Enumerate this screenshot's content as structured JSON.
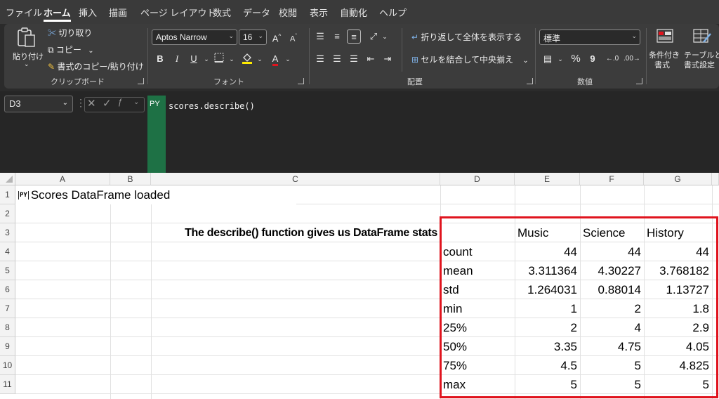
{
  "menu": {
    "tabs": [
      {
        "label": "ファイル",
        "active": false
      },
      {
        "label": "ホーム",
        "active": true
      },
      {
        "label": "挿入",
        "active": false
      },
      {
        "label": "描画",
        "active": false
      },
      {
        "label": "ページ レイアウト",
        "active": false
      },
      {
        "label": "数式",
        "active": false
      },
      {
        "label": "データ",
        "active": false
      },
      {
        "label": "校閲",
        "active": false
      },
      {
        "label": "表示",
        "active": false
      },
      {
        "label": "自動化",
        "active": false
      },
      {
        "label": "ヘルプ",
        "active": false
      }
    ]
  },
  "ribbon": {
    "clipboard": {
      "paste_label": "貼り付け",
      "cut_label": "切り取り",
      "copy_label": "コピー",
      "format_painter_label": "書式のコピー/貼り付け",
      "group_label": "クリップボード"
    },
    "font": {
      "font_name": "Aptos Narrow",
      "font_size": "16",
      "group_label": "フォント"
    },
    "alignment": {
      "wrap_text_label": "折り返して全体を表示する",
      "merge_center_label": "セルを結合して中央揃え",
      "group_label": "配置"
    },
    "number": {
      "format_value": "標準",
      "percent_label": "%",
      "comma_label": "9",
      "group_label": "数値"
    },
    "styles": {
      "conditional_label_1": "条件付き",
      "conditional_label_2": "書式",
      "table_label_1": "テーブルとし",
      "table_label_2": "書式設定"
    }
  },
  "formula_bar": {
    "name_box": "D3",
    "py_badge": "PY",
    "formula": "scores.describe()"
  },
  "sheet": {
    "columns": [
      "A",
      "B",
      "C",
      "D",
      "E",
      "F",
      "G"
    ],
    "rows": [
      "1",
      "2",
      "3",
      "4",
      "5",
      "6",
      "7",
      "8",
      "9",
      "10",
      "11"
    ],
    "a1_py_icon": "PY",
    "a1_text": "Scores DataFrame loaded",
    "c3_text": "The describe() function gives us DataFrame stats",
    "df_headers": [
      "Music",
      "Science",
      "History"
    ],
    "df_rows": [
      {
        "stat": "count",
        "values": [
          "44",
          "44",
          "44"
        ]
      },
      {
        "stat": "mean",
        "values": [
          "3.311364",
          "4.30227",
          "3.768182"
        ]
      },
      {
        "stat": "std",
        "values": [
          "1.264031",
          "0.88014",
          "1.13727"
        ]
      },
      {
        "stat": "min",
        "values": [
          "1",
          "2",
          "1.8"
        ]
      },
      {
        "stat": "25%",
        "values": [
          "2",
          "4",
          "2.9"
        ]
      },
      {
        "stat": "50%",
        "values": [
          "3.35",
          "4.75",
          "4.05"
        ]
      },
      {
        "stat": "75%",
        "values": [
          "4.5",
          "5",
          "4.825"
        ]
      },
      {
        "stat": "max",
        "values": [
          "5",
          "5",
          "5"
        ]
      }
    ],
    "highlight_color": "#e0141e"
  }
}
